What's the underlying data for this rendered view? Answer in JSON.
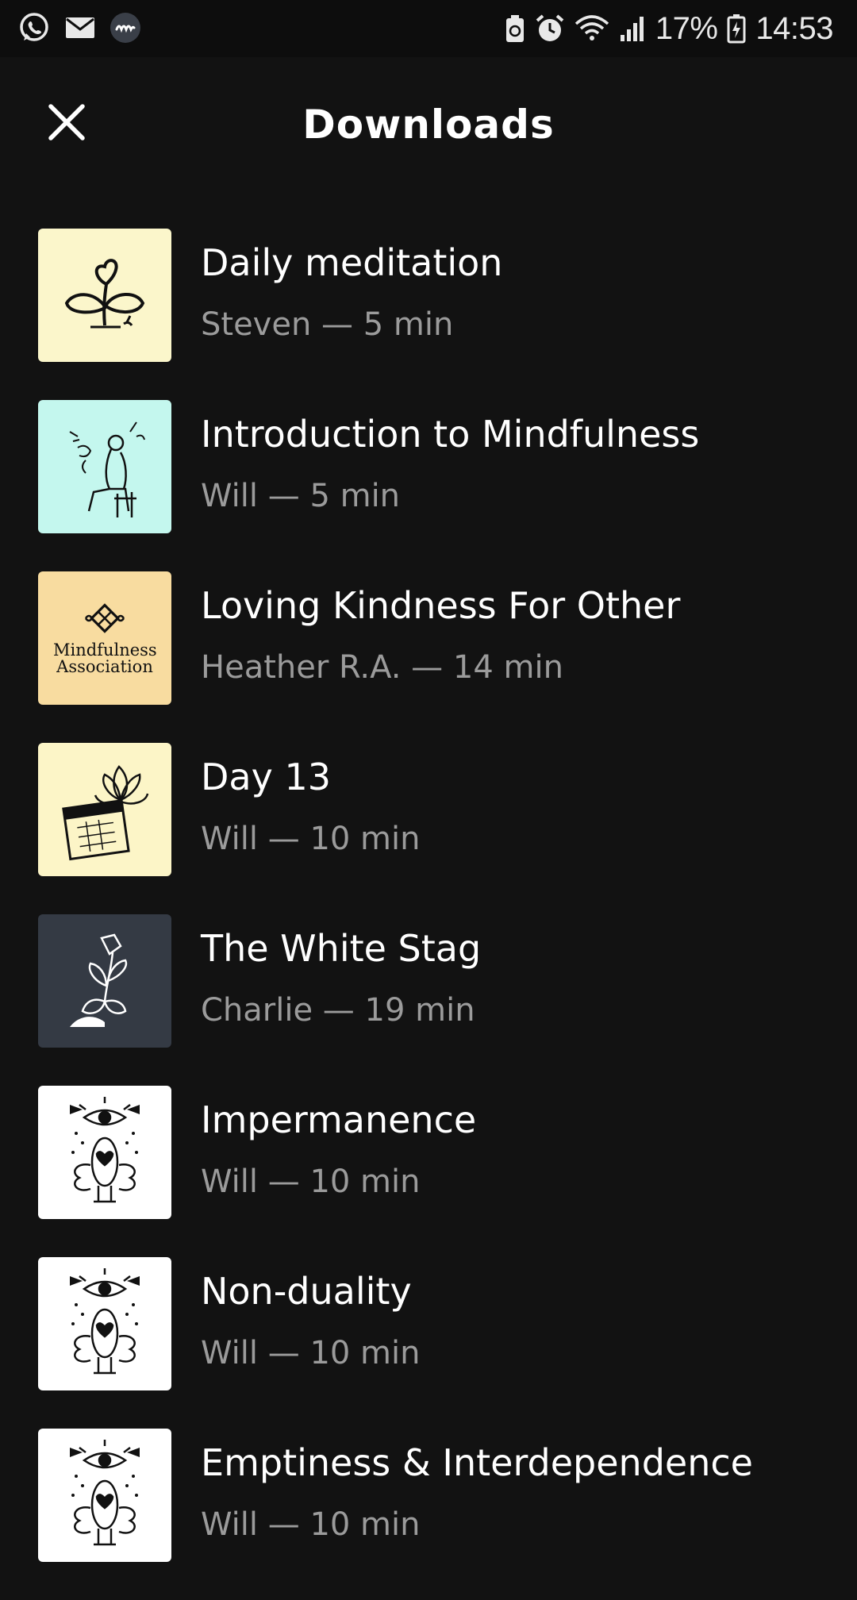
{
  "status_bar": {
    "left_icons": [
      "whatsapp-icon",
      "mail-icon",
      "app-notification-icon"
    ],
    "battery_percent": "17%",
    "time": "14:53"
  },
  "header": {
    "title": "Downloads",
    "close_icon": "close-icon"
  },
  "downloads": [
    {
      "title": "Daily meditation",
      "subtitle": "Steven — 5 min",
      "thumb_bg": "#fbf6cb",
      "art": "plant-heart"
    },
    {
      "title": "Introduction to Mindfulness",
      "subtitle": "Will — 5 min",
      "thumb_bg": "#c4f7ee",
      "art": "seated-figure"
    },
    {
      "title": "Loving Kindness For Other",
      "subtitle": "Heather R.A. — 14 min",
      "thumb_bg": "#f8dca0",
      "art": "mindfulness-association-logo",
      "thumb_text": "Mindfulness Association"
    },
    {
      "title": "Day 13",
      "subtitle": "Will — 10 min",
      "thumb_bg": "#fcf5c7",
      "art": "lotus-calendar"
    },
    {
      "title": "The White Stag",
      "subtitle": "Charlie — 19 min",
      "thumb_bg": "#343a44",
      "art": "white-sketch"
    },
    {
      "title": "Impermanence",
      "subtitle": "Will — 10 min",
      "thumb_bg": "#ffffff",
      "art": "eye-figure"
    },
    {
      "title": "Non-duality",
      "subtitle": "Will — 10 min",
      "thumb_bg": "#ffffff",
      "art": "eye-figure"
    },
    {
      "title": "Emptiness & Interdependence",
      "subtitle": "Will — 10 min",
      "thumb_bg": "#ffffff",
      "art": "eye-figure"
    }
  ]
}
